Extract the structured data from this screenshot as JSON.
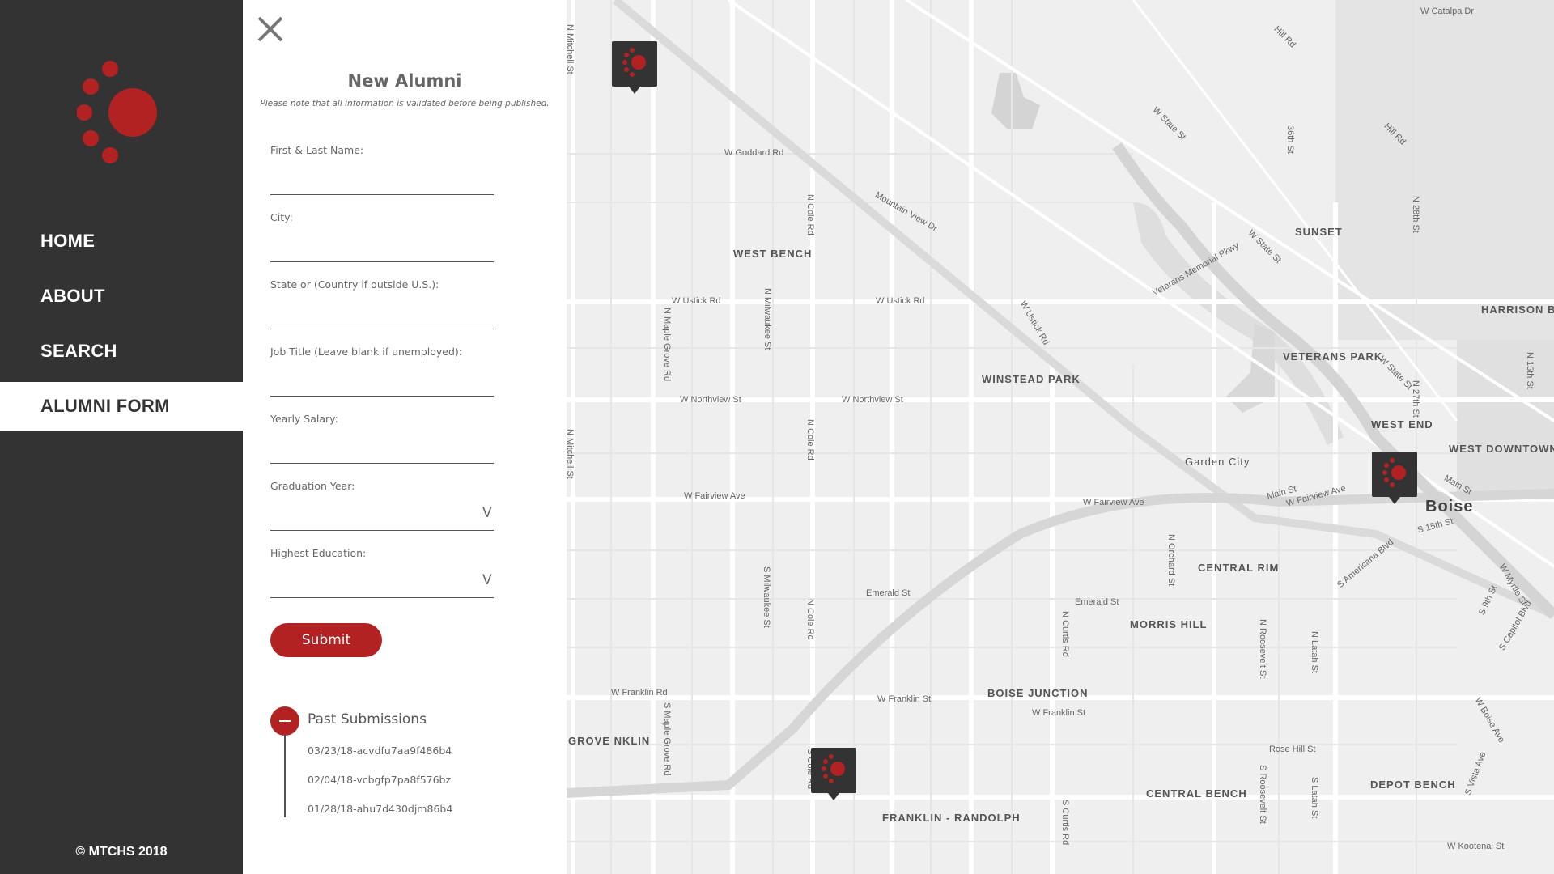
{
  "sidebar": {
    "nav": [
      {
        "label": "HOME"
      },
      {
        "label": "ABOUT"
      },
      {
        "label": "SEARCH"
      },
      {
        "label": "ALUMNI FORM",
        "active": true
      }
    ],
    "footer": "© MTCHS 2018"
  },
  "form": {
    "title": "New Alumni",
    "note": "Please note that all information is validated before being published.",
    "fields": [
      {
        "label": "First & Last Name:",
        "value": ""
      },
      {
        "label": "City:",
        "value": ""
      },
      {
        "label": "State or (Country if outside U.S.):",
        "value": ""
      },
      {
        "label": "Job Title (Leave blank if unemployed):",
        "value": ""
      },
      {
        "label": "Yearly Salary:",
        "value": ""
      },
      {
        "label": "Graduation Year:",
        "value": "",
        "dropdown": "V"
      },
      {
        "label": "Highest Education:",
        "value": "",
        "dropdown": "V"
      }
    ],
    "submit_label": "Submit",
    "past": {
      "title": "Past Submissions",
      "items": [
        "03/23/18-acvdfu7aa9f486b4",
        "02/04/18-vcbgfp7pa8f576bz",
        "01/28/18-ahu7d430djm86b4"
      ]
    }
  },
  "map": {
    "neighborhoods": [
      "WEST BENCH",
      "SUNSET",
      "HARRISON BOULEVARD",
      "WINSTEAD PARK",
      "VETERANS PARK",
      "WEST END",
      "WEST DOWNTOWN",
      "Garden City",
      "CENTRAL RIM",
      "MORRIS HILL",
      "BOISE JUNCTION",
      "GROVE NKLIN",
      "CENTRAL BENCH",
      "DEPOT BENCH",
      "FRANKLIN - RANDOLPH"
    ],
    "city": "Boise",
    "streets": [
      "W Catalpa Dr",
      "Hill Rd",
      "W State St",
      "36th St",
      "Hill Rd",
      "W Goddard Rd",
      "Mountain View Dr",
      "N Cole Rd",
      "W Ustick Rd",
      "W Ustick Rd",
      "N Milwaukee St",
      "N Maple Grove Rd",
      "W Ustick Rd",
      "Veterans Memorial Pkwy",
      "W State St",
      "N 28th St",
      "W State St",
      "W Northview St",
      "W Northview St",
      "N Cole Rd",
      "N 27th St",
      "N 15th St",
      "W Fairview Ave",
      "W Fairview Ave",
      "Main St",
      "W Fairview Ave",
      "Main St",
      "S 15th St",
      "N Orchard St",
      "Emerald St",
      "Emerald St",
      "N Cole Rd",
      "N Curtis Rd",
      "N Roosevelt St",
      "N Latah St",
      "S Americana Blvd",
      "W Myrtle St",
      "S 9th St",
      "S Capitol Blvd",
      "W Franklin Rd",
      "W Franklin St",
      "W Franklin St",
      "S Maple Grove Rd",
      "S Cole Rd",
      "Rose Hill St",
      "S Roosevelt St",
      "S Latah St",
      "S Vista Ave",
      "W Boise Ave",
      "S Curtis Rd",
      "W Kootenai St",
      "N Mitchell St",
      "N Mitchell St",
      "S Milwaukee St"
    ],
    "accent_color": "#b22222",
    "marker_count": 3
  }
}
